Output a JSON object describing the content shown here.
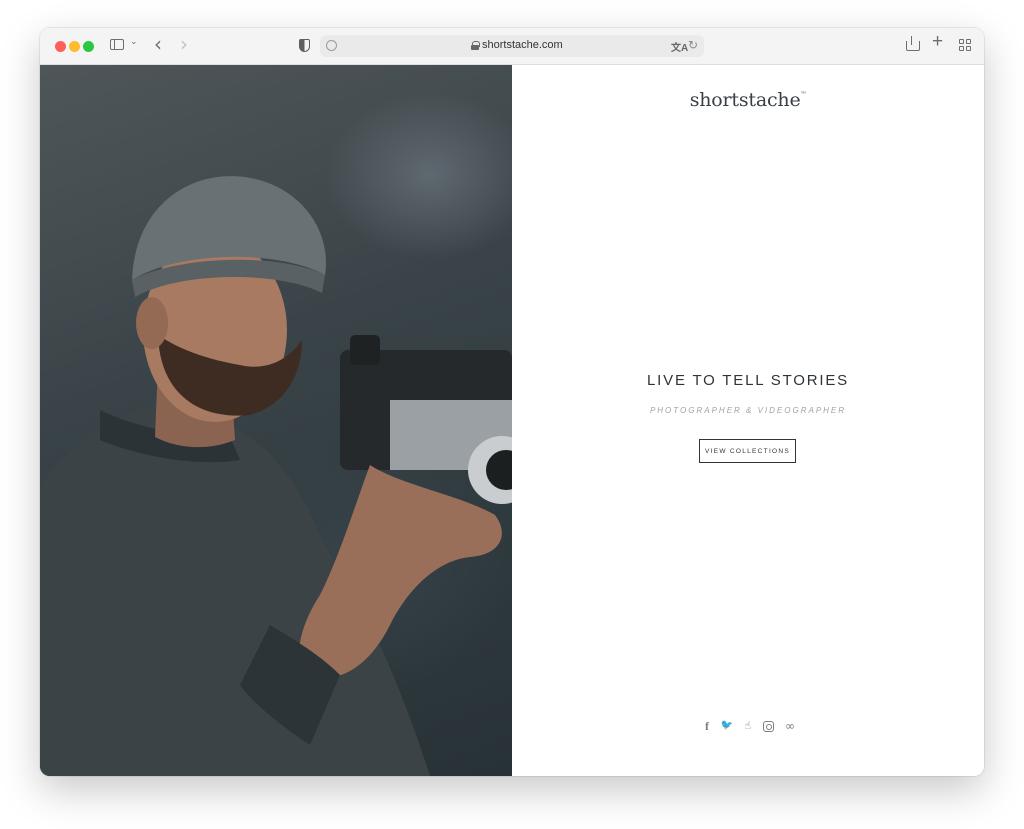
{
  "browser": {
    "url": "shortstache.com",
    "icons": {
      "sidebar": "sidebar-icon",
      "back": "chevron-left-icon",
      "forward": "chevron-right-icon",
      "privacy": "shield-icon",
      "lock": "lock-icon",
      "translate": "translate-icon",
      "reload": "reload-icon",
      "share": "share-icon",
      "new_tab": "plus-icon",
      "tab_overview": "grid-icon"
    },
    "glyphs": {
      "caret": "⌄",
      "back": "‹",
      "forward": "›",
      "translate": "文A",
      "reload": "↻",
      "plus": "+"
    }
  },
  "site": {
    "logo": "shortstache",
    "logo_mark": "™",
    "headline": "LIVE TO TELL STORIES",
    "subheadline": "PHOTOGRAPHER & VIDEOGRAPHER",
    "cta_label": "VIEW COLLECTIONS",
    "hero_image": "man-with-camera-photo",
    "social": {
      "facebook": "f",
      "twitter": "🐦",
      "flickr": "☝",
      "link": "∞"
    }
  },
  "colors": {
    "text_dark": "#2f3438",
    "text_muted": "#9ea3a8",
    "window_chrome": "#f5f4f4",
    "traffic_red": "#fe5f57",
    "traffic_yellow": "#febb2e",
    "traffic_green": "#29c840"
  }
}
